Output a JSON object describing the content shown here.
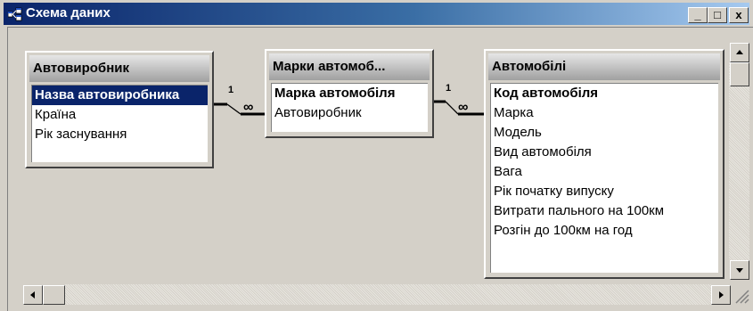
{
  "window": {
    "title": "Схема даних"
  },
  "title_buttons": {
    "minimize": "_",
    "maximize": "□",
    "close": "x"
  },
  "tables": [
    {
      "title": "Автовиробник",
      "fields": [
        "Назва автовиробника",
        "Країна",
        "Рік заснування"
      ]
    },
    {
      "title": "Марки автомоб...",
      "fields": [
        "Марка автомобіля",
        "Автовиробник"
      ]
    },
    {
      "title": "Автомобілі",
      "fields": [
        "Код автомобіля",
        "Марка",
        "Модель",
        "Вид автомобіля",
        "Вага",
        "Рік початку випуску",
        "Витрати пального на 100км",
        "Розгін до 100км на год"
      ]
    }
  ],
  "relationships": [
    {
      "one": "1",
      "many": "∞"
    },
    {
      "one": "1",
      "many": "∞"
    }
  ],
  "colors": {
    "title_bar_start": "#0a246a",
    "title_bar_end": "#a6caf0",
    "selection": "#0a246a",
    "window_face": "#d4d0c8"
  }
}
